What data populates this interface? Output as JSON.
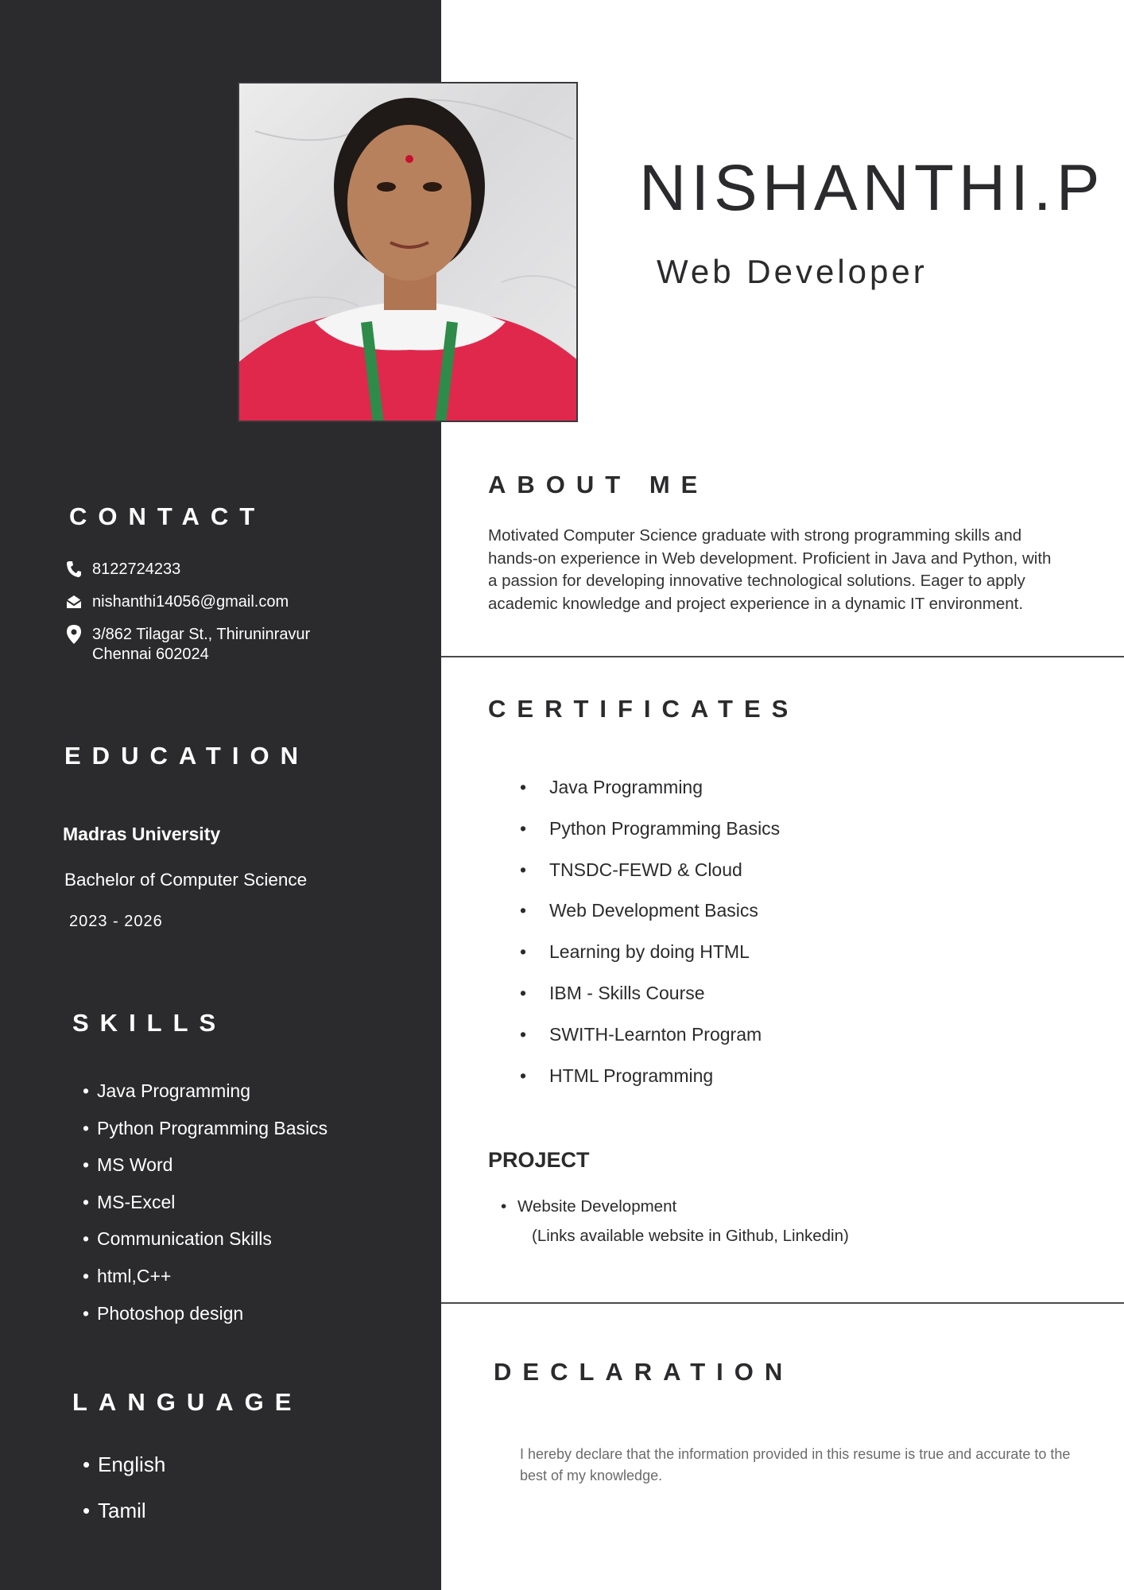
{
  "header": {
    "name": "NISHANTHI.P",
    "role": "Web Developer"
  },
  "contact": {
    "heading": "CONTACT",
    "phone": "8122724233",
    "email": "nishanthi14056@gmail.com",
    "address_line1": "3/862 Tilagar St., Thiruninravur",
    "address_line2": "Chennai 602024"
  },
  "education": {
    "heading": "EDUCATION",
    "institution": "Madras University",
    "degree": "Bachelor of Computer Science",
    "years": "2023 - 2026"
  },
  "skills": {
    "heading": "SKILLS",
    "items": [
      "Java Programming",
      "Python Programming Basics",
      "MS Word",
      "MS-Excel",
      "Communication Skills",
      "html,C++",
      "Photoshop design"
    ]
  },
  "language": {
    "heading": "LANGUAGE",
    "items": [
      "English",
      "Tamil"
    ]
  },
  "about": {
    "heading": "ABOUT ME",
    "text": "Motivated Computer Science graduate with strong programming skills and hands-on experience in Web development. Proficient in Java and Python, with a passion for developing innovative technological solutions. Eager to apply academic knowledge and project experience in a dynamic IT environment."
  },
  "certificates": {
    "heading": "CERTIFICATES",
    "items": [
      "Java Programming",
      "Python Programming Basics",
      "TNSDC-FEWD & Cloud",
      "Web Development Basics",
      "Learning by doing HTML",
      "IBM - Skills Course",
      "SWITH-Learnton Program",
      "HTML Programming"
    ]
  },
  "project": {
    "heading": "PROJECT",
    "item": "Website Development",
    "note": "(Links available website in Github, Linkedin)"
  },
  "declaration": {
    "heading": "DECLARATION",
    "text": "I hereby declare that the information provided in this resume is true and accurate to the best of my knowledge."
  },
  "colors": {
    "sidebar": "#2b2b2d",
    "text_dark": "#2b2b2d",
    "text_light": "#ffffff",
    "muted": "#6b6b6d"
  }
}
